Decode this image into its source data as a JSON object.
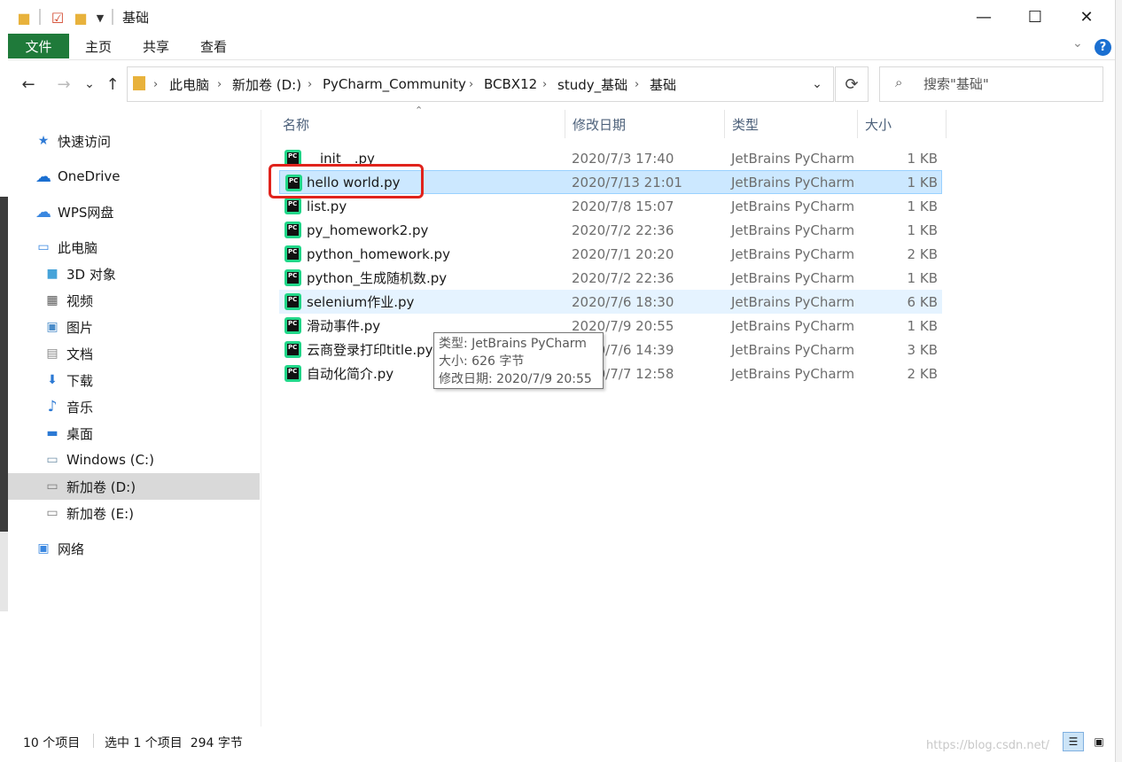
{
  "window": {
    "title": "基础",
    "minimize_glyph": "—",
    "maximize_glyph": "☐",
    "close_glyph": "✕"
  },
  "ribbon": {
    "tabs": [
      "文件",
      "主页",
      "共享",
      "查看"
    ],
    "help_glyph": "?",
    "collapse_glyph": "⌄"
  },
  "nav": {
    "back_glyph": "←",
    "forward_glyph": "→",
    "recent_glyph": "⌄",
    "up_glyph": "↑",
    "breadcrumbs": [
      "此电脑",
      "新加卷 (D:)",
      "PyCharm_Community",
      "BCBX12",
      "study_基础",
      "基础"
    ],
    "separator": "›",
    "dropdown_glyph": "⌄",
    "refresh_glyph": "⟳",
    "search_placeholder": "搜索\"基础\"",
    "search_icon": "search-icon"
  },
  "sidebar": {
    "items": [
      {
        "label": "快速访问",
        "icon": "star-icon",
        "glyph": "★",
        "color": "#2f7bd6"
      },
      {
        "label": "OneDrive",
        "icon": "cloud-icon",
        "glyph": "☁",
        "color": "#1a6fd1"
      },
      {
        "label": "WPS网盘",
        "icon": "cloud-outline-icon",
        "glyph": "☁",
        "color": "#3a87e0"
      },
      {
        "label": "此电脑",
        "icon": "computer-icon",
        "glyph": "▭",
        "color": "#3a87e0"
      },
      {
        "label": "3D 对象",
        "icon": "cube-icon",
        "glyph": "■",
        "color": "#46a3d9"
      },
      {
        "label": "视频",
        "icon": "film-icon",
        "glyph": "▦",
        "color": "#5a5a5a"
      },
      {
        "label": "图片",
        "icon": "picture-icon",
        "glyph": "▣",
        "color": "#4a8cc9"
      },
      {
        "label": "文档",
        "icon": "document-icon",
        "glyph": "▤",
        "color": "#888888"
      },
      {
        "label": "下载",
        "icon": "download-icon",
        "glyph": "⬇",
        "color": "#2b79d4"
      },
      {
        "label": "音乐",
        "icon": "music-icon",
        "glyph": "♪",
        "color": "#2b79d4"
      },
      {
        "label": "桌面",
        "icon": "desktop-icon",
        "glyph": "▬",
        "color": "#2b79d4"
      },
      {
        "label": "Windows (C:)",
        "icon": "drive-c-icon",
        "glyph": "▭",
        "color": "#6f8fa8"
      },
      {
        "label": "新加卷 (D:)",
        "icon": "drive-d-icon",
        "glyph": "▭",
        "color": "#7a7a7a"
      },
      {
        "label": "新加卷 (E:)",
        "icon": "drive-e-icon",
        "glyph": "▭",
        "color": "#7a7a7a"
      },
      {
        "label": "网络",
        "icon": "network-icon",
        "glyph": "▣",
        "color": "#3a87e0"
      }
    ]
  },
  "columns": [
    "名称",
    "修改日期",
    "类型",
    "大小"
  ],
  "files": [
    {
      "name": "__init__.py",
      "date": "2020/7/3 17:40",
      "type": "JetBrains PyCharm",
      "size": "1 KB"
    },
    {
      "name": "hello world.py",
      "date": "2020/7/13 21:01",
      "type": "JetBrains PyCharm",
      "size": "1 KB"
    },
    {
      "name": "list.py",
      "date": "2020/7/8 15:07",
      "type": "JetBrains PyCharm",
      "size": "1 KB"
    },
    {
      "name": "py_homework2.py",
      "date": "2020/7/2 22:36",
      "type": "JetBrains PyCharm",
      "size": "1 KB"
    },
    {
      "name": "python_homework.py",
      "date": "2020/7/1 20:20",
      "type": "JetBrains PyCharm",
      "size": "2 KB"
    },
    {
      "name": "python_生成随机数.py",
      "date": "2020/7/2 22:36",
      "type": "JetBrains PyCharm",
      "size": "1 KB"
    },
    {
      "name": "selenium作业.py",
      "date": "2020/7/6 18:30",
      "type": "JetBrains PyCharm",
      "size": "6 KB"
    },
    {
      "name": "滑动事件.py",
      "date": "2020/7/9 20:55",
      "type": "JetBrains PyCharm",
      "size": "1 KB"
    },
    {
      "name": "云商登录打印title.py",
      "date": "2020/7/6 14:39",
      "type": "JetBrains PyCharm",
      "size": "3 KB"
    },
    {
      "name": "自动化简介.py",
      "date": "2020/7/7 12:58",
      "type": "JetBrains PyCharm",
      "size": "2 KB"
    }
  ],
  "file_icon_text": "PC",
  "tooltip": {
    "type_line": "类型: JetBrains PyCharm",
    "size_line": "大小: 626 字节",
    "date_line": "修改日期: 2020/7/9 20:55"
  },
  "status": {
    "item_count": "10 个项目",
    "selection": "选中 1 个项目  294 字节",
    "details_view_glyph": "☰",
    "thumb_view_glyph": "▣"
  },
  "watermark": "https://blog.csdn.net/",
  "colors": {
    "accent_file_tab": "#1f7a3a",
    "selection_bg": "#cce8ff",
    "highlight_box": "#e0231c",
    "help_blue": "#1a6fd1"
  }
}
